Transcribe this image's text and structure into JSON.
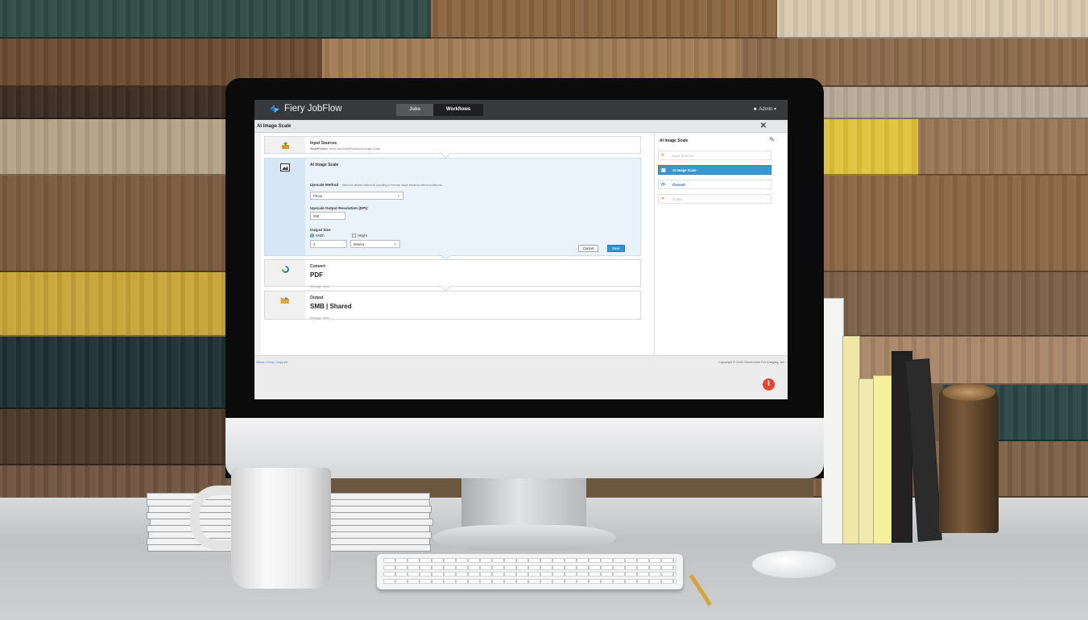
{
  "app": {
    "brand": "Fiery JobFlow",
    "tabs": [
      {
        "label": "Jobs"
      },
      {
        "label": "Workflows"
      }
    ],
    "user": "Admin",
    "page_title": "AI Image Scale"
  },
  "steps": {
    "input": {
      "title": "Input Sources",
      "prefix": "SmartFolder:",
      "path": "\\\\erch-dev\\SmartFolders\\AI Image Scale"
    },
    "scale": {
      "title": "AI Image Scale",
      "method_label": "Upscale Method",
      "method_hint": "Select the desired method for upscaling to increase image resolution without quality loss",
      "method_value": "Photo",
      "dpi_label": "Upscale Output Resolution (DPI):",
      "dpi_value": "200",
      "size_label": "Output Size",
      "width_label": "Width",
      "height_label": "Height",
      "size_value": "3",
      "unit_value": "Meters",
      "cancel": "Cancel",
      "save": "Save"
    },
    "convert": {
      "title": "Convert",
      "value": "PDF",
      "link": "Manage rules"
    },
    "output": {
      "title": "Output",
      "value": "SMB | Shared",
      "link": "Manage rules"
    }
  },
  "sidebar": {
    "title": "AI Image Scale",
    "items": [
      {
        "label": "Input Sources"
      },
      {
        "label": "AI Image Scale"
      },
      {
        "label": "Convert"
      },
      {
        "label": "Output"
      }
    ]
  },
  "footer": {
    "about": "About",
    "help": "Help",
    "support": "Support",
    "sep": "|",
    "copyright": "Copyright © 2020 Electronics For Imaging, Inc."
  },
  "colors": {
    "accent": "#3a97d3",
    "topbar": "#38393c",
    "info": "#e8432e"
  }
}
